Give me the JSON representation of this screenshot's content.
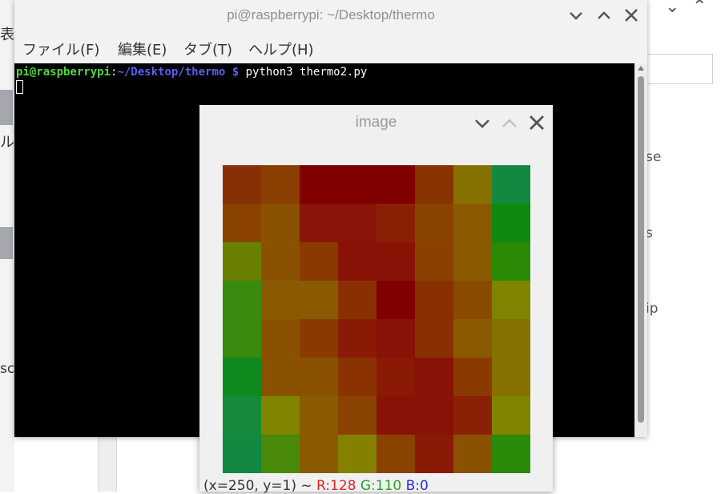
{
  "background_window": {
    "left_chars": [
      "表",
      "ル"
    ],
    "right_fragments": [
      "se",
      "s",
      "ip"
    ],
    "left_bottom_fragment": "sc"
  },
  "terminal": {
    "title": "pi@raspberrypi: ~/Desktop/thermo",
    "menu": [
      "ファイル(F)",
      "編集(E)",
      "タブ(T)",
      "ヘルプ(H)"
    ],
    "prompt_user": "pi@raspberrypi",
    "prompt_sep": ":",
    "prompt_path": "~/Desktop/thermo $",
    "command": " python3 thermo2.py",
    "colors": {
      "user": "#4fd83a",
      "path": "#5a5ff2",
      "background": "#000000"
    }
  },
  "image_window": {
    "title": "image",
    "status": {
      "coords": "(x=250, y=1) ~",
      "r": "R:128",
      "g": "G:110",
      "b": "B:0"
    },
    "heatmap_colors": [
      [
        "#883005",
        "#8a3f00",
        "#800000",
        "#800000",
        "#800000",
        "#883400",
        "#857000",
        "#128840"
      ],
      [
        "#8b4200",
        "#8a5200",
        "#881508",
        "#881508",
        "#8a1f05",
        "#8a4200",
        "#8a5a00",
        "#0e8a10"
      ],
      [
        "#6a8000",
        "#8a5200",
        "#8a3a00",
        "#881205",
        "#881205",
        "#8a4000",
        "#8a5a00",
        "#2a8a05"
      ],
      [
        "#3a8a10",
        "#8a5a00",
        "#8a5a00",
        "#8a3000",
        "#800000",
        "#8a3000",
        "#8a4a00",
        "#808500"
      ],
      [
        "#3a8a10",
        "#8a5200",
        "#8a3a00",
        "#8a1a05",
        "#881205",
        "#8a3000",
        "#8a5a00",
        "#857000"
      ],
      [
        "#0e8a1e",
        "#8a5200",
        "#8a5200",
        "#8a3200",
        "#8a1a05",
        "#881205",
        "#8a3a00",
        "#857000"
      ],
      [
        "#168a3a",
        "#808500",
        "#8a5a00",
        "#8a4200",
        "#881205",
        "#881205",
        "#8a2005",
        "#808500"
      ],
      [
        "#128840",
        "#4a8a0a",
        "#8a5a00",
        "#848000",
        "#8a4200",
        "#8a1a05",
        "#8a5200",
        "#2a8a0a"
      ]
    ]
  }
}
